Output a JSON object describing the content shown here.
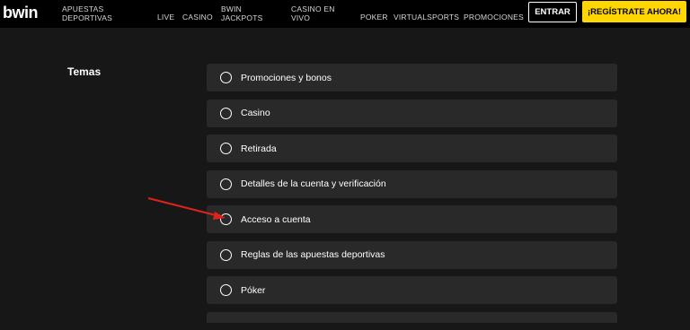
{
  "header": {
    "logo": "bwin",
    "nav": [
      {
        "label": "APUESTAS\nDEPORTIVAS",
        "name": "nav-apuestas-deportivas"
      },
      {
        "label": "LIVE",
        "name": "nav-live"
      },
      {
        "label": "CASINO",
        "name": "nav-casino"
      },
      {
        "label": "BWIN\nJACKPOTS",
        "name": "nav-bwin-jackpots"
      },
      {
        "label": "CASINO EN\nVIVO",
        "name": "nav-casino-en-vivo"
      },
      {
        "label": "POKER",
        "name": "nav-poker"
      },
      {
        "label": "VIRTUALSPORTS",
        "name": "nav-virtualsports"
      },
      {
        "label": "PROMOCIONES",
        "name": "nav-promociones"
      }
    ],
    "login_label": "ENTRAR",
    "register_label": "¡REGÍSTRATE AHORA!"
  },
  "main": {
    "section_title": "Temas",
    "topics": [
      "Promociones y bonos",
      "Casino",
      "Retirada",
      "Detalles de la cuenta y verificación",
      "Acceso a cuenta",
      "Reglas de las apuestas deportivas",
      "Póker"
    ]
  },
  "annotation": {
    "arrow_color": "#e0221b",
    "points_to_topic": "Acceso a cuenta"
  }
}
